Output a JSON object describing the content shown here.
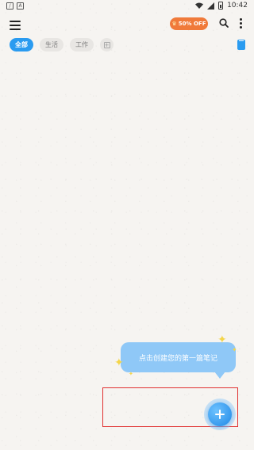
{
  "status_bar": {
    "time": "10:42",
    "left_icons": [
      "notification-icon",
      "a-icon"
    ]
  },
  "toolbar": {
    "promo_label": "50% OFF",
    "promo_color": "#f07a3a"
  },
  "categories": [
    {
      "label": "全部",
      "active": true
    },
    {
      "label": "生活",
      "active": false
    },
    {
      "label": "工作",
      "active": false
    }
  ],
  "hint": {
    "text": "点击创建您的第一篇笔记"
  },
  "colors": {
    "accent": "#2a9bf0",
    "bubble": "#8fc8f7",
    "highlight": "#e03030",
    "background": "#f6f4f1"
  }
}
